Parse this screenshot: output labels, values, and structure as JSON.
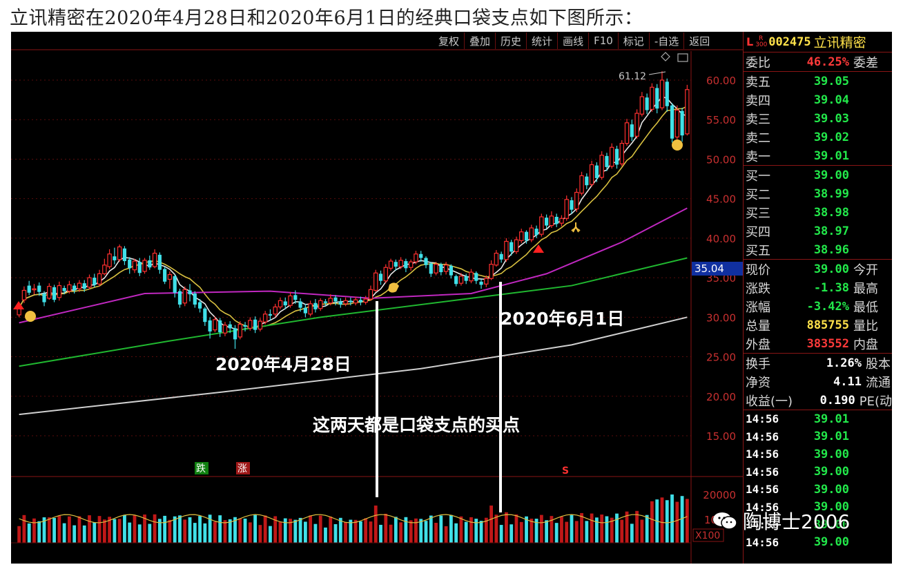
{
  "header": {
    "title": "立讯精密在2020年4月28日和2020年6月1日的经典口袋支点如下图所示："
  },
  "toolbar": {
    "buttons": [
      "复权",
      "叠加",
      "历史",
      "统计",
      "画线",
      "F10",
      "标记",
      "-自选",
      "返回"
    ]
  },
  "stock": {
    "market_prefix": "L",
    "index_tag": "R 300",
    "code": "002475",
    "name": "立讯精密"
  },
  "quote_panel": {
    "weibi": {
      "label": "委比",
      "value": "46.25%",
      "extra": "委差"
    },
    "asks": [
      {
        "label": "卖五",
        "price": "39.05"
      },
      {
        "label": "卖四",
        "price": "39.04"
      },
      {
        "label": "卖三",
        "price": "39.03"
      },
      {
        "label": "卖二",
        "price": "39.02"
      },
      {
        "label": "卖一",
        "price": "39.01"
      }
    ],
    "bids": [
      {
        "label": "买一",
        "price": "39.00"
      },
      {
        "label": "买二",
        "price": "38.99"
      },
      {
        "label": "买三",
        "price": "38.98"
      },
      {
        "label": "买四",
        "price": "38.97"
      },
      {
        "label": "买五",
        "price": "38.96"
      }
    ],
    "stats": [
      {
        "label": "现价",
        "value": "39.00",
        "extra": "今开",
        "color": "green"
      },
      {
        "label": "涨跌",
        "value": "-1.38",
        "extra": "最高",
        "color": "green"
      },
      {
        "label": "涨幅",
        "value": "-3.42%",
        "extra": "最低",
        "color": "green"
      },
      {
        "label": "总量",
        "value": "885755",
        "extra": "量比",
        "color": "yellow"
      },
      {
        "label": "外盘",
        "value": "383552",
        "extra": "内盘",
        "color": "red"
      }
    ],
    "stats2": [
      {
        "label": "换手",
        "value": "1.26%",
        "extra": "股本"
      },
      {
        "label": "净资",
        "value": "4.11",
        "extra": "流通"
      },
      {
        "label": "收益(一)",
        "value": "0.190",
        "extra": "PE(动"
      }
    ],
    "ticks": [
      {
        "time": "14:56",
        "price": "39.01"
      },
      {
        "time": "14:56",
        "price": "39.01"
      },
      {
        "time": "14:56",
        "price": "39.00"
      },
      {
        "time": "14:56",
        "price": "39.00"
      },
      {
        "time": "14:56",
        "price": "39.00"
      },
      {
        "time": "14:56",
        "price": "39.00"
      },
      {
        "time": "14:56",
        "price": "39.00"
      },
      {
        "time": "14:56",
        "price": "39.00"
      }
    ]
  },
  "chart_data": {
    "type": "candlestick",
    "y_axis_ticks": [
      "60.00",
      "55.00",
      "50.00",
      "45.00",
      "40.00",
      "35.00",
      "30.00",
      "25.00",
      "20.00",
      "15.00"
    ],
    "ylim": [
      15,
      60
    ],
    "current_price_tag": "35.04",
    "peak_label": "61.12",
    "volume_axis": [
      "20000",
      "10"
    ],
    "volume_multiplier": "X100",
    "markers": {
      "fall": "跌",
      "rise": "涨",
      "signal": "S"
    },
    "annotations": {
      "date1": "2020年4月28日",
      "date2": "2020年6月1日",
      "note": "这两天都是口袋支点的买点"
    },
    "candles": [
      [
        0,
        30.3,
        31.2,
        30.0,
        31.4
      ],
      [
        1,
        32.2,
        33.4,
        31.8,
        33.9
      ],
      [
        2,
        34.0,
        33.1,
        32.8,
        34.6
      ],
      [
        3,
        33.5,
        33.6,
        32.9,
        34.2
      ],
      [
        4,
        34.0,
        33.2,
        32.7,
        34.4
      ],
      [
        5,
        33.0,
        31.9,
        31.4,
        33.3
      ],
      [
        6,
        32.4,
        33.9,
        32.2,
        34.3
      ],
      [
        7,
        33.8,
        32.2,
        31.9,
        34.1
      ],
      [
        8,
        32.5,
        34.0,
        32.1,
        34.5
      ],
      [
        9,
        33.7,
        33.3,
        32.9,
        34.0
      ],
      [
        10,
        33.3,
        34.1,
        33.0,
        34.6
      ],
      [
        11,
        34.0,
        33.4,
        33.0,
        34.3
      ],
      [
        12,
        33.6,
        34.3,
        33.2,
        34.7
      ],
      [
        13,
        34.3,
        33.6,
        33.2,
        34.7
      ],
      [
        14,
        33.8,
        35.0,
        33.5,
        35.4
      ],
      [
        15,
        35.0,
        34.1,
        33.8,
        35.5
      ],
      [
        16,
        34.2,
        35.5,
        33.9,
        36.0
      ],
      [
        17,
        35.5,
        36.6,
        35.3,
        37.4
      ],
      [
        18,
        36.4,
        38.0,
        36.1,
        38.6
      ],
      [
        19,
        37.7,
        37.2,
        36.7,
        38.8
      ],
      [
        20,
        37.3,
        38.9,
        37.0,
        39.2
      ],
      [
        21,
        38.7,
        37.1,
        36.6,
        39.0
      ],
      [
        22,
        37.3,
        36.2,
        35.5,
        37.6
      ],
      [
        23,
        36.0,
        37.1,
        35.6,
        37.4
      ],
      [
        24,
        37.0,
        35.6,
        35.2,
        37.5
      ],
      [
        25,
        35.8,
        37.2,
        35.5,
        37.5
      ],
      [
        26,
        37.2,
        36.3,
        36.0,
        37.8
      ],
      [
        27,
        36.4,
        38.1,
        36.2,
        38.6
      ],
      [
        28,
        37.9,
        36.0,
        35.5,
        38.2
      ],
      [
        29,
        36.1,
        34.5,
        34.2,
        36.4
      ],
      [
        30,
        34.8,
        35.4,
        33.6,
        35.8
      ],
      [
        31,
        35.2,
        33.1,
        32.5,
        35.4
      ],
      [
        32,
        33.3,
        31.6,
        31.2,
        33.6
      ],
      [
        33,
        31.8,
        33.5,
        31.4,
        33.9
      ],
      [
        34,
        33.4,
        32.9,
        32.0,
        34.2
      ],
      [
        35,
        33.0,
        31.6,
        31.2,
        33.3
      ],
      [
        36,
        31.9,
        31.1,
        30.6,
        32.3
      ],
      [
        37,
        31.1,
        29.4,
        28.9,
        31.3
      ],
      [
        38,
        29.6,
        28.2,
        27.3,
        30.0
      ],
      [
        39,
        28.4,
        29.7,
        28.1,
        30.1
      ],
      [
        40,
        29.6,
        28.1,
        27.5,
        29.9
      ],
      [
        41,
        28.0,
        29.0,
        27.6,
        29.4
      ],
      [
        42,
        29.1,
        28.6,
        28.0,
        29.5
      ],
      [
        43,
        28.6,
        27.2,
        26.0,
        29.0
      ],
      [
        44,
        27.5,
        29.1,
        27.2,
        29.5
      ],
      [
        45,
        29.0,
        28.8,
        28.2,
        29.4
      ],
      [
        46,
        28.6,
        29.6,
        28.3,
        30.0
      ],
      [
        47,
        29.7,
        28.4,
        28.0,
        30.1
      ],
      [
        48,
        28.5,
        29.5,
        28.2,
        29.9
      ],
      [
        49,
        29.4,
        30.4,
        29.1,
        30.8
      ],
      [
        50,
        30.4,
        30.2,
        29.6,
        31.0
      ],
      [
        51,
        30.4,
        31.3,
        30.0,
        31.7
      ],
      [
        52,
        31.3,
        32.1,
        31.0,
        32.5
      ],
      [
        53,
        32.0,
        31.5,
        31.0,
        32.5
      ],
      [
        54,
        31.5,
        32.7,
        31.2,
        33.2
      ],
      [
        55,
        32.8,
        32.2,
        31.7,
        33.4
      ],
      [
        56,
        32.0,
        31.2,
        30.7,
        32.4
      ],
      [
        57,
        31.2,
        30.5,
        30.0,
        31.7
      ],
      [
        58,
        30.4,
        31.7,
        30.1,
        32.1
      ],
      [
        59,
        31.8,
        31.0,
        30.6,
        32.3
      ],
      [
        60,
        31.1,
        32.1,
        30.8,
        32.4
      ],
      [
        61,
        32.0,
        31.8,
        31.4,
        32.3
      ],
      [
        62,
        31.8,
        32.4,
        31.5,
        32.9
      ],
      [
        63,
        32.5,
        32.0,
        31.5,
        32.8
      ],
      [
        64,
        32.0,
        31.6,
        31.2,
        32.4
      ],
      [
        65,
        31.7,
        32.1,
        31.4,
        32.5
      ],
      [
        66,
        32.1,
        31.9,
        31.5,
        32.5
      ],
      [
        67,
        31.8,
        32.2,
        31.5,
        32.6
      ],
      [
        68,
        32.2,
        31.9,
        31.5,
        32.6
      ],
      [
        69,
        31.9,
        32.3,
        31.6,
        32.7
      ],
      [
        70,
        32.3,
        33.5,
        32.1,
        34.0
      ],
      [
        71,
        33.4,
        35.6,
        33.2,
        36.0
      ],
      [
        72,
        35.5,
        34.6,
        34.1,
        35.9
      ],
      [
        73,
        34.6,
        36.3,
        34.3,
        36.7
      ],
      [
        74,
        36.2,
        37.1,
        35.9,
        37.4
      ],
      [
        75,
        37.0,
        36.4,
        35.9,
        37.3
      ],
      [
        76,
        36.4,
        37.2,
        36.1,
        37.6
      ],
      [
        77,
        37.1,
        36.2,
        35.7,
        37.4
      ],
      [
        78,
        36.3,
        37.0,
        35.9,
        37.3
      ],
      [
        79,
        37.0,
        38.0,
        36.7,
        38.4
      ],
      [
        80,
        38.0,
        37.5,
        37.0,
        38.4
      ],
      [
        81,
        37.5,
        36.6,
        36.2,
        37.7
      ],
      [
        82,
        36.8,
        35.5,
        35.1,
        37.0
      ],
      [
        83,
        35.6,
        36.7,
        35.3,
        37.0
      ],
      [
        84,
        36.7,
        35.7,
        35.3,
        36.9
      ],
      [
        85,
        35.8,
        36.6,
        35.4,
        37.0
      ],
      [
        86,
        36.5,
        35.3,
        34.9,
        36.7
      ],
      [
        87,
        35.2,
        34.2,
        33.9,
        35.4
      ],
      [
        88,
        34.3,
        35.2,
        34.0,
        35.6
      ],
      [
        89,
        35.2,
        34.6,
        34.2,
        35.5
      ],
      [
        90,
        34.6,
        35.7,
        34.3,
        36.1
      ],
      [
        91,
        35.6,
        34.6,
        34.2,
        35.8
      ],
      [
        92,
        34.5,
        34.1,
        33.6,
        34.8
      ],
      [
        93,
        34.2,
        34.9,
        33.8,
        35.3
      ],
      [
        94,
        34.9,
        36.7,
        34.7,
        37.2
      ],
      [
        95,
        36.6,
        38.1,
        36.4,
        38.5
      ],
      [
        96,
        38.0,
        37.3,
        36.9,
        38.3
      ],
      [
        97,
        37.3,
        39.6,
        37.0,
        40.0
      ],
      [
        98,
        39.5,
        38.3,
        37.8,
        39.8
      ],
      [
        99,
        38.3,
        39.8,
        38.0,
        40.2
      ],
      [
        100,
        39.7,
        40.8,
        39.4,
        41.2
      ],
      [
        101,
        40.8,
        39.7,
        39.3,
        41.0
      ],
      [
        102,
        39.8,
        41.3,
        39.5,
        41.7
      ],
      [
        103,
        41.2,
        40.4,
        40.0,
        41.6
      ],
      [
        104,
        40.5,
        42.7,
        40.2,
        43.1
      ],
      [
        105,
        42.6,
        41.6,
        41.2,
        43.0
      ],
      [
        106,
        41.6,
        42.8,
        41.3,
        43.4
      ],
      [
        107,
        42.7,
        41.8,
        41.4,
        43.1
      ],
      [
        108,
        41.9,
        42.5,
        41.5,
        42.9
      ],
      [
        109,
        42.5,
        44.9,
        42.2,
        45.4
      ],
      [
        110,
        44.8,
        43.6,
        43.1,
        45.2
      ],
      [
        111,
        43.7,
        45.8,
        43.3,
        46.3
      ],
      [
        112,
        45.7,
        47.9,
        45.4,
        48.4
      ],
      [
        113,
        47.8,
        46.7,
        46.2,
        48.2
      ],
      [
        114,
        46.8,
        49.3,
        46.5,
        49.8
      ],
      [
        115,
        49.2,
        47.6,
        47.1,
        49.6
      ],
      [
        116,
        47.7,
        50.5,
        47.4,
        51.0
      ],
      [
        117,
        50.4,
        49.0,
        48.5,
        50.8
      ],
      [
        118,
        49.1,
        51.5,
        48.8,
        52.0
      ],
      [
        119,
        51.3,
        49.3,
        48.8,
        51.7
      ],
      [
        120,
        49.4,
        52.0,
        49.1,
        52.4
      ],
      [
        121,
        52.0,
        54.6,
        51.7,
        55.1
      ],
      [
        122,
        54.4,
        52.8,
        52.3,
        55.0
      ],
      [
        123,
        52.9,
        55.8,
        52.6,
        56.3
      ],
      [
        124,
        55.7,
        57.9,
        55.4,
        58.5
      ],
      [
        125,
        57.8,
        56.2,
        55.7,
        58.3
      ],
      [
        126,
        56.3,
        59.1,
        56.0,
        59.6
      ],
      [
        127,
        59.0,
        56.4,
        55.8,
        59.5
      ],
      [
        128,
        56.5,
        60.0,
        56.2,
        61.12
      ],
      [
        129,
        59.8,
        56.7,
        56.0,
        60.2
      ],
      [
        130,
        56.8,
        52.6,
        52.1,
        57.1
      ],
      [
        131,
        52.8,
        56.2,
        52.5,
        56.8
      ],
      [
        132,
        56.1,
        53.0,
        52.2,
        56.5
      ],
      [
        133,
        53.2,
        58.8,
        53.0,
        59.4
      ]
    ]
  },
  "watermark": {
    "text": "陶博士2006"
  }
}
